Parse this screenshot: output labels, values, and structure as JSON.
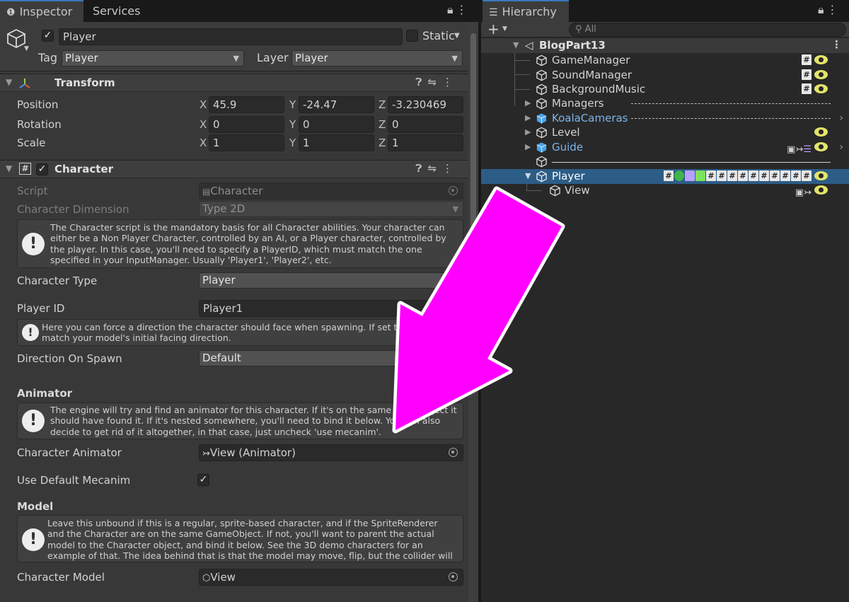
{
  "colors": {
    "accent": "#3a79bb",
    "prefab_text": "#7cb6ec",
    "selection": "#2c5d87",
    "arrow": "#ff00ff",
    "eye": "#e4e46a"
  },
  "inspector": {
    "tabs": [
      {
        "label": "Inspector",
        "icon": "info-icon"
      },
      {
        "label": "Services"
      }
    ],
    "object": {
      "name": "Player",
      "active": true,
      "static_label": "Static",
      "tag_label": "Tag",
      "tag_value": "Player",
      "layer_label": "Layer",
      "layer_value": "Player"
    },
    "transform": {
      "title": "Transform",
      "rows": [
        {
          "label": "Position",
          "x": "45.9",
          "y": "-24.47",
          "z": "-3.230469"
        },
        {
          "label": "Rotation",
          "x": "0",
          "y": "0",
          "z": "0"
        },
        {
          "label": "Scale",
          "x": "1",
          "y": "1",
          "z": "1"
        }
      ]
    },
    "character": {
      "title": "Character",
      "script_label": "Script",
      "script_value": "Character",
      "dimension_label": "Character Dimension",
      "dimension_value": "Type 2D",
      "help1": "The Character script is the mandatory basis for all Character abilities. Your character can either be a Non Player Character, controlled by an AI, or a Player character, controlled by the player. In this case, you'll need to specify a PlayerID, which must match the one specified in your InputManager. Usually 'Player1', 'Player2', etc.",
      "type_label": "Character Type",
      "type_value": "Player",
      "playerid_label": "Player ID",
      "playerid_value": "Player1",
      "help2": "Here you can force a direction the character should face when spawning. If set to default, it'll match your model's initial facing direction.",
      "direction_label": "Direction On Spawn",
      "direction_value": "Default",
      "animator_section": "Animator",
      "help3": "The engine will try and find an animator for this character. If it's on the same gameObject it should have found it. If it's nested somewhere, you'll need to bind it below. You can also decide to get rid of it altogether, in that case, just uncheck 'use mecanim'.",
      "animator_label": "Character Animator",
      "animator_value": "View (Animator)",
      "mecanim_label": "Use Default Mecanim",
      "mecanim_checked": true,
      "model_section": "Model",
      "help4": "Leave this unbound if this is a regular, sprite-based character, and if the SpriteRenderer and the Character are on the same GameObject. If not, you'll want to parent the actual model to the Character object, and bind it below. See the 3D demo characters for an example of that. The idea behind that is that the model may move, flip, but the collider will remain",
      "model_label": "Character Model",
      "model_value": "View"
    }
  },
  "hierarchy": {
    "tab": "Hierarchy",
    "search_placeholder": "All",
    "add_label": "+",
    "scene": "BlogPart13",
    "items": [
      {
        "name": "GameManager",
        "badges": "#"
      },
      {
        "name": "SoundManager",
        "badges": "#"
      },
      {
        "name": "BackgroundMusic",
        "badges": "#"
      },
      {
        "name": "Managers",
        "badges": ""
      },
      {
        "name": "KoalaCameras",
        "badges": ""
      },
      {
        "name": "Level",
        "badges": ""
      },
      {
        "name": "Guide",
        "badges": ""
      },
      {
        "name": "",
        "badges": ""
      },
      {
        "name": "Player",
        "badges": ""
      },
      {
        "name": "View",
        "badges": ""
      }
    ]
  }
}
